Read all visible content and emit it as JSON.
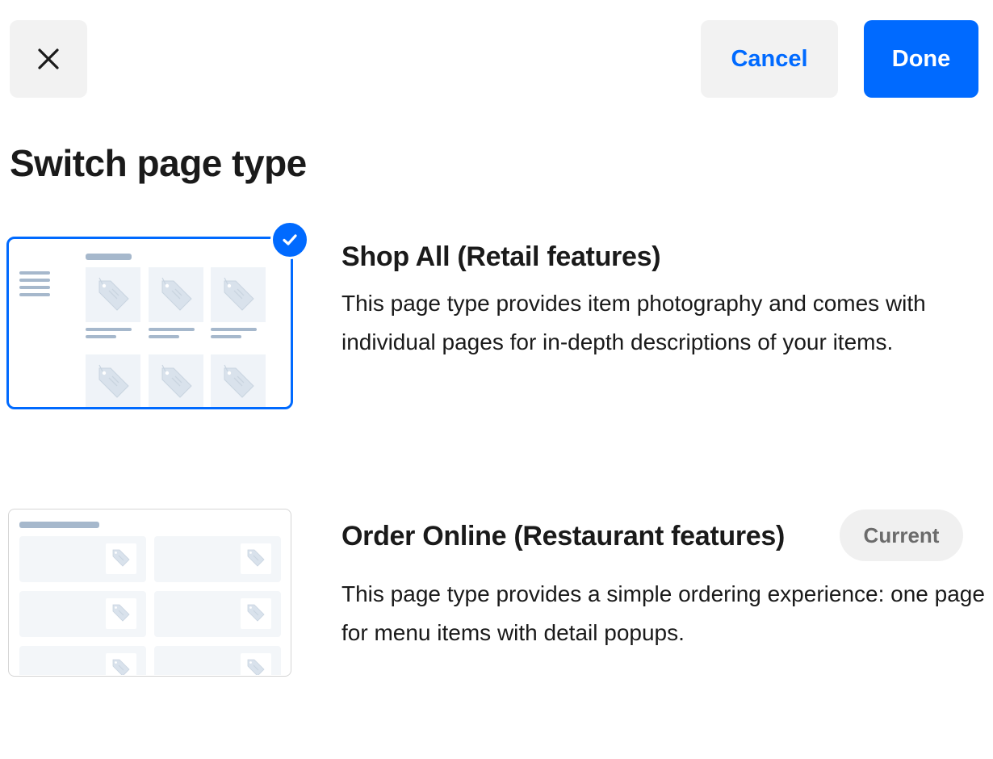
{
  "toolbar": {
    "cancel_label": "Cancel",
    "done_label": "Done",
    "close_icon": "close-icon"
  },
  "page": {
    "title": "Switch page type"
  },
  "options": [
    {
      "title": "Shop All (Retail features)",
      "description": "This page type provides item photography and comes with individual pages for in-depth descriptions of your items.",
      "selected": true,
      "icon": "check-icon"
    },
    {
      "title": "Order Online (Restaurant features)",
      "description": "This page type provides a simple ordering experience: one page for menu items with detail popups.",
      "badge": "Current",
      "selected": false
    }
  ],
  "colors": {
    "accent": "#006aff",
    "button_secondary_bg": "#f2f2f2",
    "badge_bg": "#f0f0f0",
    "badge_text": "#6b6b6b",
    "placeholder_bar": "#a6b8cc",
    "placeholder_tile": "#eff3f8"
  }
}
